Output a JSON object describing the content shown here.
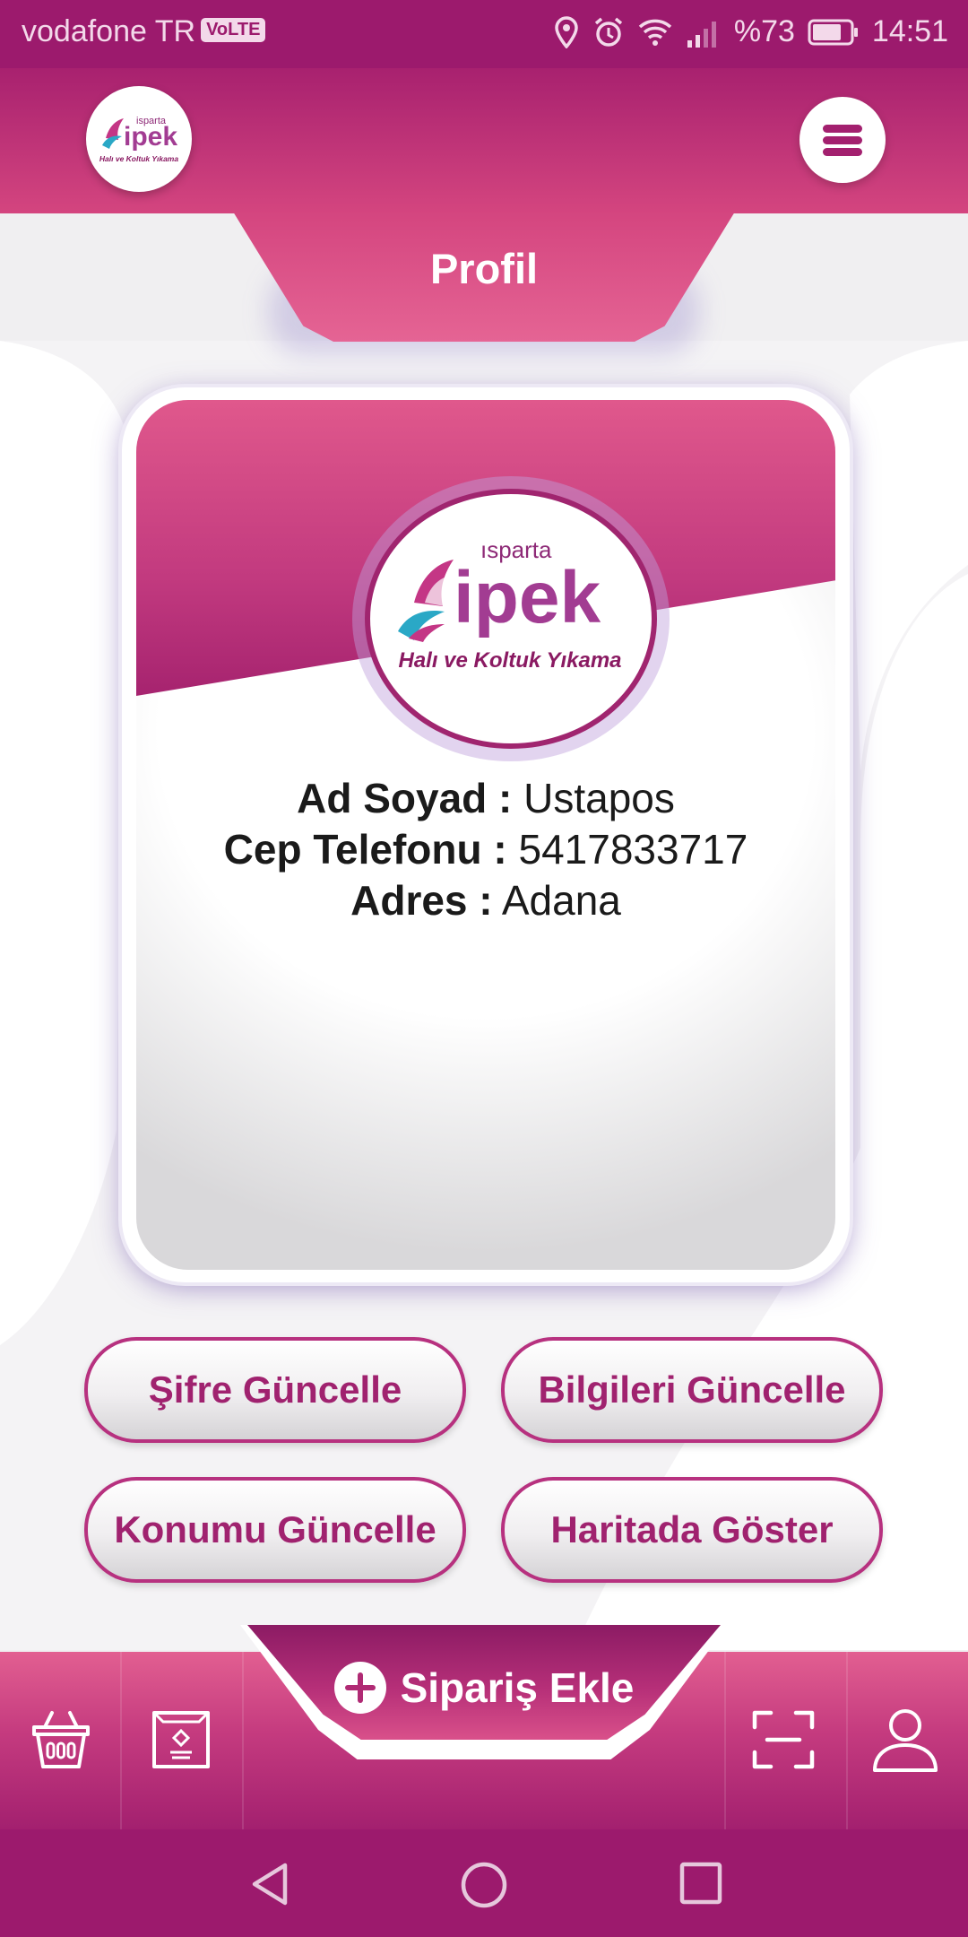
{
  "status_bar": {
    "carrier": "vodafone TR",
    "volte": "VoLTE",
    "battery": "%73",
    "time": "14:51"
  },
  "header": {
    "logo": {
      "brand": "ipek",
      "city": "ısparta",
      "tagline": "Halı ve Koltuk Yıkama"
    },
    "menu_icon": "hamburger-icon"
  },
  "page_title": "Profil",
  "profile": {
    "name_label": "Ad Soyad :",
    "name_value": "Ustapos",
    "phone_label": "Cep Telefonu :",
    "phone_value": "5417833717",
    "address_label": "Adres :",
    "address_value": "Adana"
  },
  "actions": {
    "change_password": "Şifre Güncelle",
    "update_info": "Bilgileri Güncelle",
    "update_location": "Konumu Güncelle",
    "show_on_map": "Haritada Göster"
  },
  "bottom_nav": {
    "add_order": "Sipariş Ekle",
    "icons": [
      "basket-icon",
      "package-icon",
      "scan-icon",
      "user-icon"
    ]
  },
  "colors": {
    "primary": "#9c1a6d",
    "accent": "#e25f91",
    "button_text": "#a0226f"
  }
}
